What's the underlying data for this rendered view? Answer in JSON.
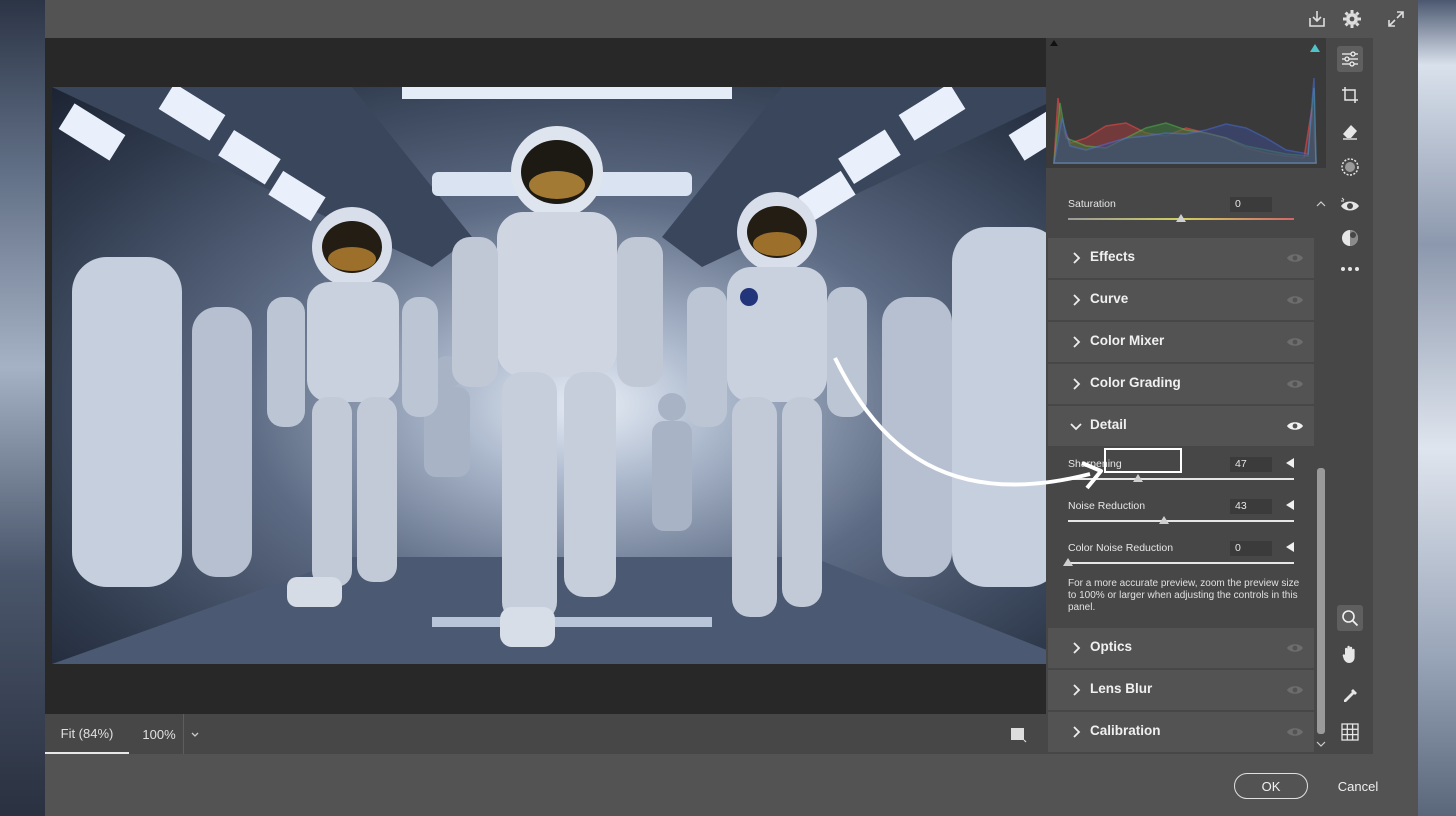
{
  "zoom_bar": {
    "fit_label": "Fit (84%)",
    "hundred_label": "100%"
  },
  "sections_top": [
    {
      "label": "Effects"
    },
    {
      "label": "Curve"
    },
    {
      "label": "Color Mixer"
    },
    {
      "label": "Color Grading"
    },
    {
      "label": "Detail"
    }
  ],
  "saturation": {
    "label": "Saturation",
    "value": "0"
  },
  "detail": {
    "sharpening": {
      "label": "Sharpening",
      "value": "47"
    },
    "noise_reduction": {
      "label": "Noise Reduction",
      "value": "43"
    },
    "color_noise_reduction": {
      "label": "Color Noise Reduction",
      "value": "0"
    },
    "note": "For a more accurate preview, zoom the preview size to 100% or larger when adjusting the controls in this panel."
  },
  "sections_bottom": [
    {
      "label": "Optics"
    },
    {
      "label": "Lens Blur"
    },
    {
      "label": "Calibration"
    }
  ],
  "buttons": {
    "ok": "OK",
    "cancel": "Cancel"
  },
  "colors": {
    "dialog": "#535353",
    "panel": "#474747",
    "canvas": "#282828",
    "accent": "#4fc3c8"
  },
  "icons": {
    "top": [
      "download-icon",
      "gear-icon",
      "expand-icon"
    ],
    "rail": [
      "sliders-icon",
      "crop-icon",
      "eraser-icon",
      "mask-icon",
      "red-eye-icon",
      "presets-icon",
      "more-icon",
      "zoom-icon",
      "hand-icon",
      "eyedropper-icon",
      "grid-icon"
    ]
  }
}
